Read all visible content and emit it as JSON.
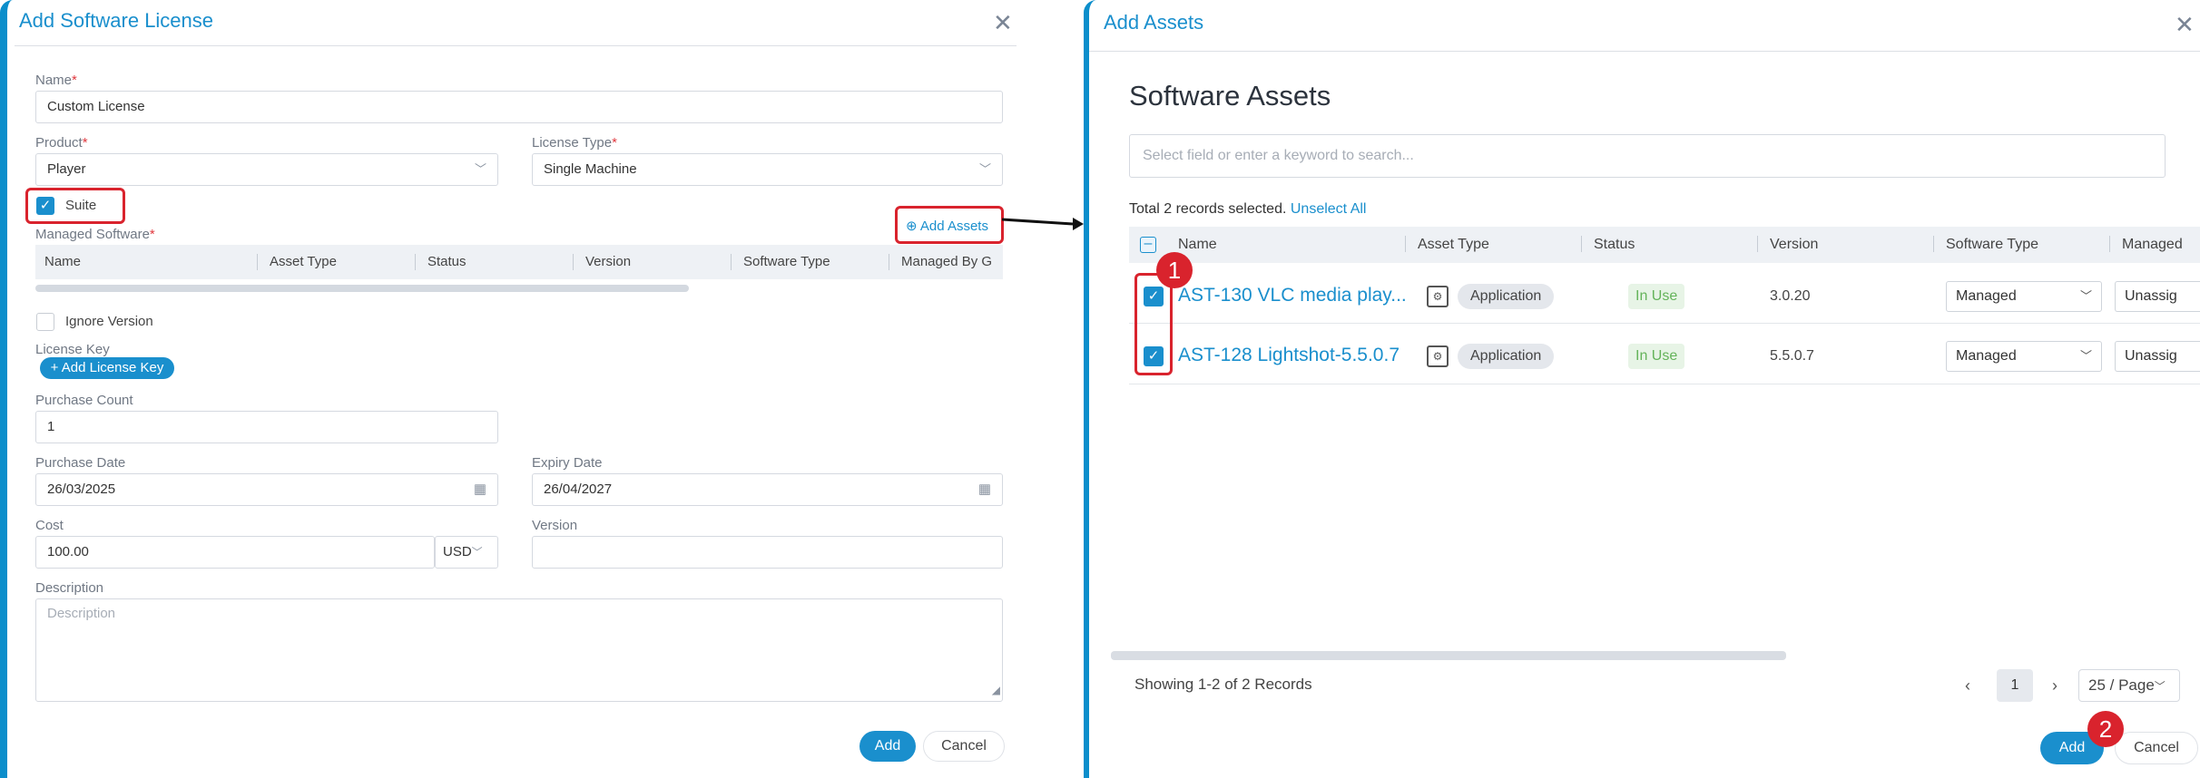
{
  "left": {
    "title": "Add Software License",
    "close_icon": "close-icon",
    "name": {
      "label": "Name",
      "required": "*",
      "value": "Custom License"
    },
    "product": {
      "label": "Product",
      "required": "*",
      "value": "Player"
    },
    "license_type": {
      "label": "License Type",
      "required": "*",
      "value": "Single Machine"
    },
    "suite": {
      "label": "Suite",
      "checked": true
    },
    "managed_software": {
      "label": "Managed Software",
      "required": "*"
    },
    "add_assets_label": "Add Assets",
    "grid_columns": [
      "Name",
      "Asset Type",
      "Status",
      "Version",
      "Software Type",
      "Managed By G"
    ],
    "ignore_version": {
      "label": "Ignore Version",
      "checked": false
    },
    "license_key": {
      "label": "License Key",
      "button": "Add License Key"
    },
    "purchase_count": {
      "label": "Purchase Count",
      "value": "1"
    },
    "purchase_date": {
      "label": "Purchase Date",
      "value": "26/03/2025"
    },
    "expiry_date": {
      "label": "Expiry Date",
      "value": "26/04/2027"
    },
    "cost": {
      "label": "Cost",
      "value": "100.00",
      "currency": "USD"
    },
    "version": {
      "label": "Version",
      "value": ""
    },
    "description": {
      "label": "Description",
      "placeholder": "Description"
    },
    "add_button": "Add",
    "cancel_button": "Cancel"
  },
  "right": {
    "title": "Add Assets",
    "close_icon": "close-icon",
    "heading": "Software Assets",
    "search_placeholder": "Select field or enter a keyword to search...",
    "selection_text": "Total 2 records selected.",
    "unselect_all": "Unselect All",
    "columns": [
      "Name",
      "Asset Type",
      "Status",
      "Version",
      "Software Type",
      "Managed"
    ],
    "rows": [
      {
        "name": "AST-130 VLC media play...",
        "asset_type": "Application",
        "status": "In Use",
        "version": "3.0.20",
        "software_type": "Managed",
        "managed_by": "Unassig"
      },
      {
        "name": "AST-128 Lightshot-5.5.0.7",
        "asset_type": "Application",
        "status": "In Use",
        "version": "5.5.0.7",
        "software_type": "Managed",
        "managed_by": "Unassig"
      }
    ],
    "showing_text": "Showing 1-2 of 2 Records",
    "current_page": "1",
    "page_size": "25 / Page",
    "add_button": "Add",
    "cancel_button": "Cancel"
  },
  "annotations": {
    "badge_1": "1",
    "badge_2": "2"
  },
  "colors": {
    "accent": "#1a8fcd",
    "highlight": "#d9232d",
    "in_use": "#64b35a"
  }
}
